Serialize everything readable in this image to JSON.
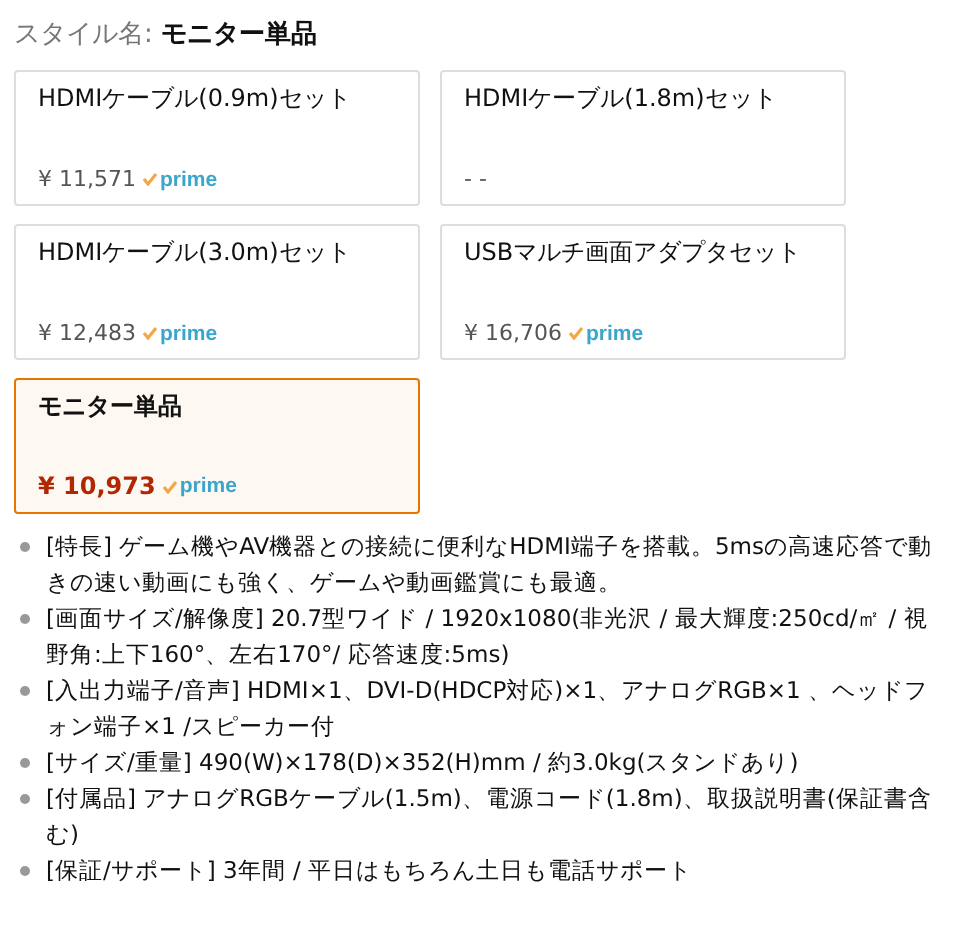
{
  "style_label": {
    "label": "スタイル名:",
    "value": "モニター単品"
  },
  "options": [
    {
      "name": "HDMIケーブル(0.9m)セット",
      "price": "¥ 11,571",
      "prime": "prime",
      "selected": false
    },
    {
      "name": "HDMIケーブル(1.8m)セット",
      "price": "- -",
      "selected": false
    },
    {
      "name": "HDMIケーブル(3.0m)セット",
      "price": "¥ 12,483",
      "prime": "prime",
      "selected": false
    },
    {
      "name": "USBマルチ画面アダプタセット",
      "price": "¥ 16,706",
      "prime": "prime",
      "selected": false
    },
    {
      "name": "モニター単品",
      "price": "¥ 10,973",
      "prime": "prime",
      "selected": true
    }
  ],
  "features": [
    "[特長] ゲーム機やAV機器との接続に便利なHDMI端子を搭載。5msの高速応答で動きの速い動画にも強く、ゲームや動画鑑賞にも最適。",
    "[画面サイズ/解像度] 20.7型ワイド / 1920x1080(非光沢 / 最大輝度:250cd/㎡ / 視野角:上下160°、左右170°/ 応答速度:5ms)",
    "[入出力端子/音声] HDMI×1、DVI-D(HDCP対応)×1、アナログRGB×1 、ヘッドフォン端子×1 /スピーカー付",
    "[サイズ/重量] 490(W)×178(D)×352(H)mm / 約3.0kg(スタンドあり)",
    "[付属品] アナログRGBケーブル(1.5m)、電源コード(1.8m)、取扱説明書(保証書含む)",
    "[保証/サポート] 3年間 / 平日はもちろん土日も電話サポート"
  ]
}
